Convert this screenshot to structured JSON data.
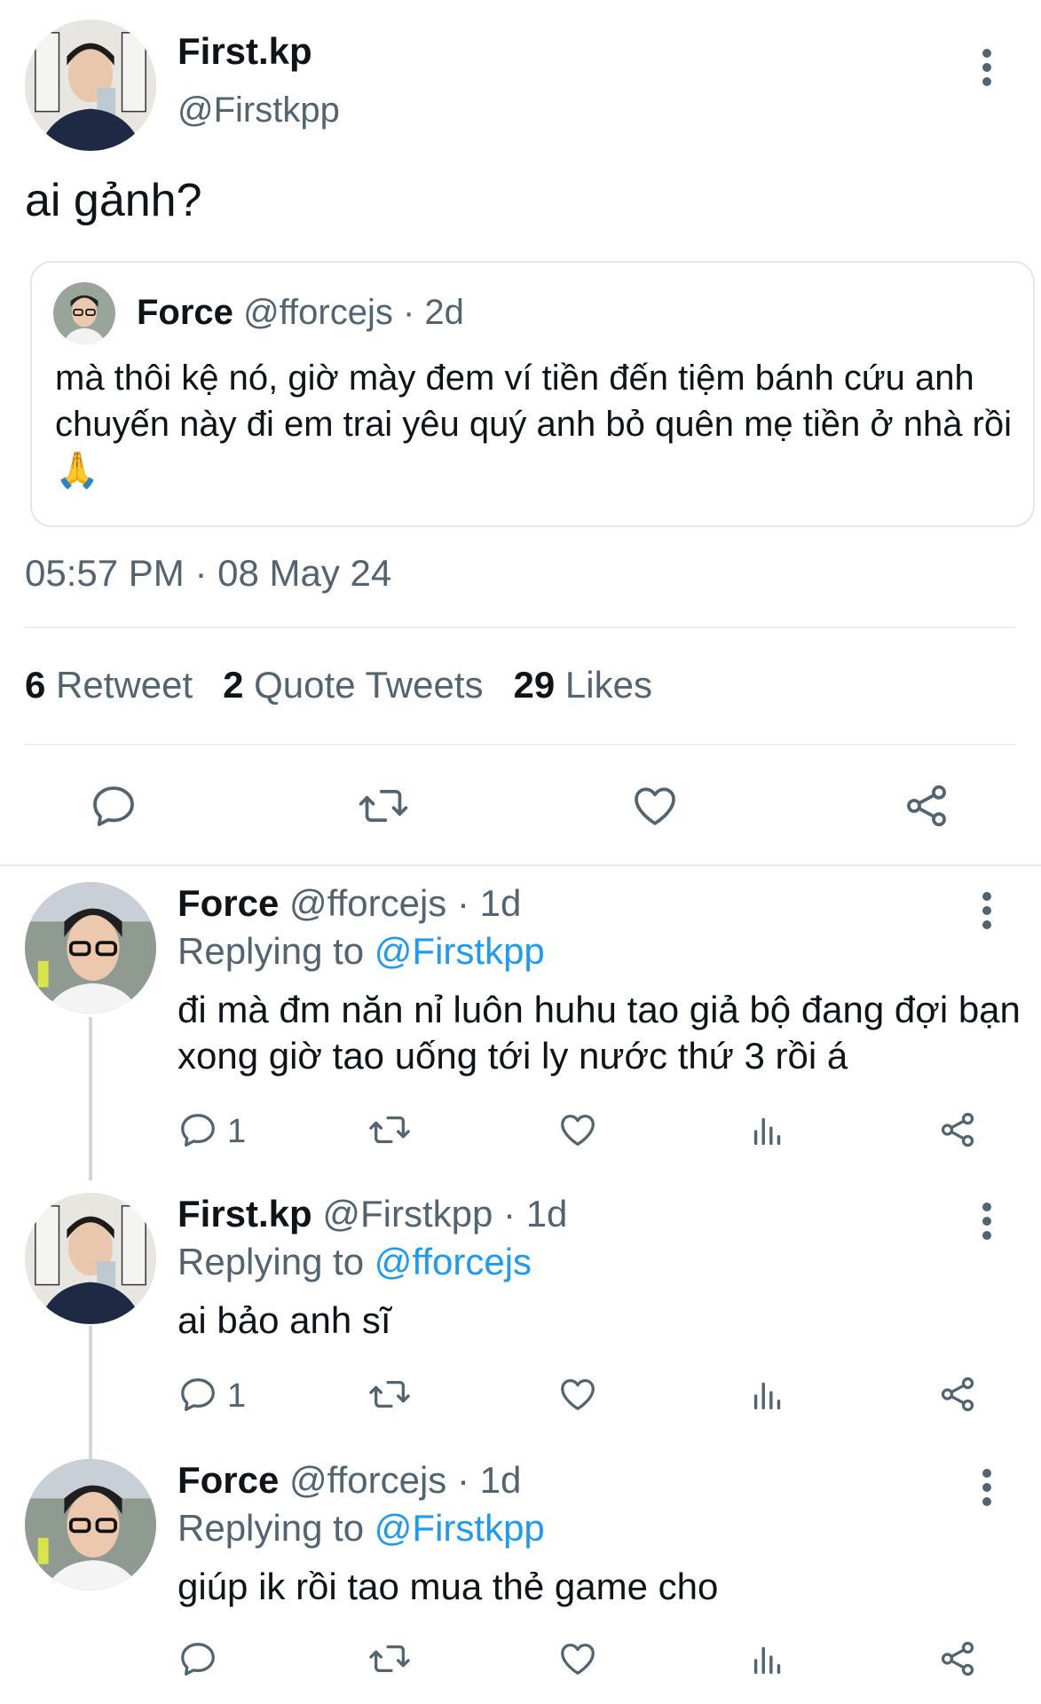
{
  "main_tweet": {
    "author_name": "First.kp",
    "author_handle": "@Firstkpp",
    "text": "ai gảnh?",
    "quoted": {
      "author_name": "Force",
      "author_handle": "@fforcejs",
      "age": "2d",
      "separator": " · ",
      "text": "mà thôi kệ nó, giờ mày đem ví tiền đến tiệm bánh cứu anh chuyến này đi em trai yêu quý anh bỏ quên mẹ tiền ở nhà rồi 🙏"
    },
    "timestamp": "05:57 PM · 08 May 24",
    "stats": {
      "retweets": "6",
      "retweets_label": "Retweet",
      "quotes": "2",
      "quotes_label": "Quote Tweets",
      "likes": "29",
      "likes_label": "Likes"
    }
  },
  "replies": [
    {
      "author_name": "Force",
      "author_handle": "@fforcejs",
      "age": "· 1d",
      "replying_label": "Replying to",
      "replying_to": "@Firstkpp",
      "text": "đi mà đm năn nỉ luôn huhu tao giả bộ đang đợi bạn xong giờ tao uống tới ly nước thứ 3 rồi á",
      "reply_count": "1"
    },
    {
      "author_name": "First.kp",
      "author_handle": "@Firstkpp",
      "age": "· 1d",
      "replying_label": "Replying to",
      "replying_to": "@fforcejs",
      "text": "ai bảo anh sĩ",
      "reply_count": "1"
    },
    {
      "author_name": "Force",
      "author_handle": "@fforcejs",
      "age": "· 1d",
      "replying_label": "Replying to",
      "replying_to": "@Firstkpp",
      "text": "giúp ik rồi tao mua thẻ game cho",
      "reply_count": ""
    }
  ],
  "icons": {
    "more": "more-vertical-icon",
    "reply": "reply-icon",
    "retweet": "retweet-icon",
    "like": "heart-icon",
    "analytics": "analytics-icon",
    "share": "share-icon"
  },
  "colors": {
    "text": "#0f1419",
    "muted": "#536471",
    "link": "#1d9bf0",
    "divider": "#eceff1"
  }
}
